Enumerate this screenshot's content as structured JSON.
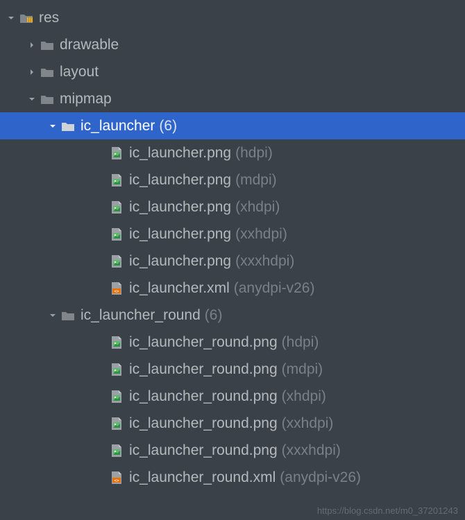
{
  "tree": {
    "res": {
      "label": "res",
      "drawable": {
        "label": "drawable"
      },
      "layout": {
        "label": "layout"
      },
      "mipmap": {
        "label": "mipmap",
        "ic_launcher": {
          "label": "ic_launcher",
          "count": "(6)",
          "files": [
            {
              "name": "ic_launcher.png",
              "qualifier": "(hdpi)"
            },
            {
              "name": "ic_launcher.png",
              "qualifier": "(mdpi)"
            },
            {
              "name": "ic_launcher.png",
              "qualifier": "(xhdpi)"
            },
            {
              "name": "ic_launcher.png",
              "qualifier": "(xxhdpi)"
            },
            {
              "name": "ic_launcher.png",
              "qualifier": "(xxxhdpi)"
            },
            {
              "name": "ic_launcher.xml",
              "qualifier": "(anydpi-v26)"
            }
          ]
        },
        "ic_launcher_round": {
          "label": "ic_launcher_round",
          "count": "(6)",
          "files": [
            {
              "name": "ic_launcher_round.png",
              "qualifier": "(hdpi)"
            },
            {
              "name": "ic_launcher_round.png",
              "qualifier": "(mdpi)"
            },
            {
              "name": "ic_launcher_round.png",
              "qualifier": "(xhdpi)"
            },
            {
              "name": "ic_launcher_round.png",
              "qualifier": "(xxhdpi)"
            },
            {
              "name": "ic_launcher_round.png",
              "qualifier": "(xxxhdpi)"
            },
            {
              "name": "ic_launcher_round.xml",
              "qualifier": "(anydpi-v26)"
            }
          ]
        }
      }
    }
  },
  "watermark": "https://blog.csdn.net/m0_37201243"
}
